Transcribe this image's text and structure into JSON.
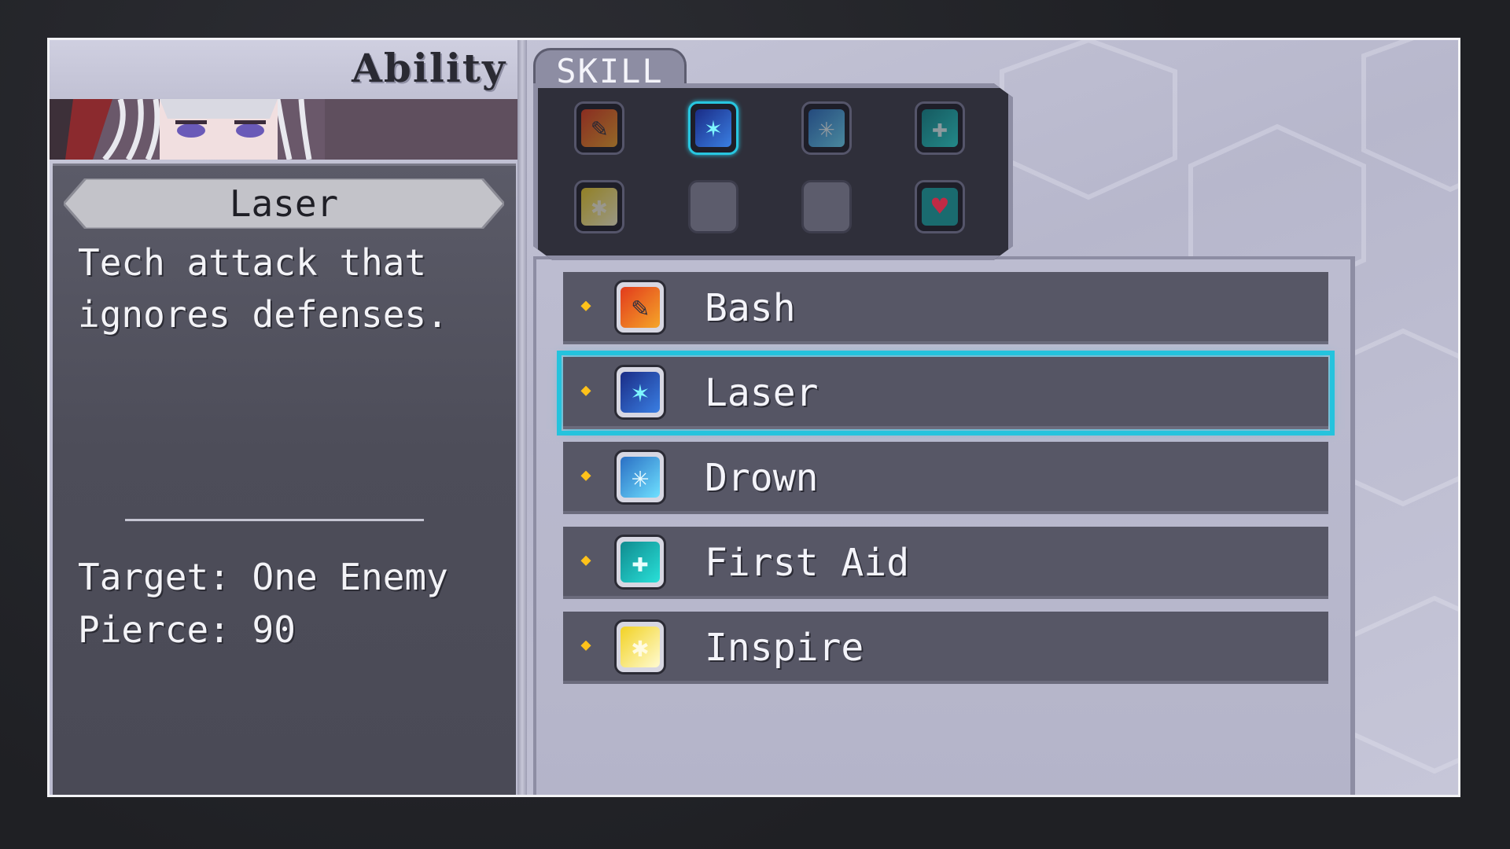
{
  "screen": {
    "ability_title": "Ability",
    "tab_label": "SKILL"
  },
  "detail": {
    "skill_name": "Laser",
    "description_line1": "Tech attack that",
    "description_line2": "ignores defenses.",
    "target": "Target: One Enemy",
    "pierce": "Pierce: 90"
  },
  "icon_grid": [
    {
      "icon": "bash-icon",
      "selected": false,
      "empty": false
    },
    {
      "icon": "laser-icon",
      "selected": true,
      "empty": false
    },
    {
      "icon": "drown-icon",
      "selected": false,
      "empty": false
    },
    {
      "icon": "first-aid-icon",
      "selected": false,
      "empty": false
    },
    {
      "icon": "inspire-icon",
      "selected": false,
      "empty": false
    },
    {
      "icon": "empty-slot",
      "selected": false,
      "empty": true
    },
    {
      "icon": "empty-slot",
      "selected": false,
      "empty": true
    },
    {
      "icon": "heart-icon",
      "selected": false,
      "empty": false
    }
  ],
  "skills": [
    {
      "label": "Bash",
      "icon": "bash-icon",
      "selected": false
    },
    {
      "label": "Laser",
      "icon": "laser-icon",
      "selected": true
    },
    {
      "label": "Drown",
      "icon": "drown-icon",
      "selected": false
    },
    {
      "label": "First Aid",
      "icon": "first-aid-icon",
      "selected": false
    },
    {
      "label": "Inspire",
      "icon": "inspire-icon",
      "selected": false
    }
  ],
  "colors": {
    "selection": "#24c3dd",
    "bullet": "#ffc21a",
    "panel_dark": "#575766",
    "panel_light": "#bcbcd0"
  }
}
